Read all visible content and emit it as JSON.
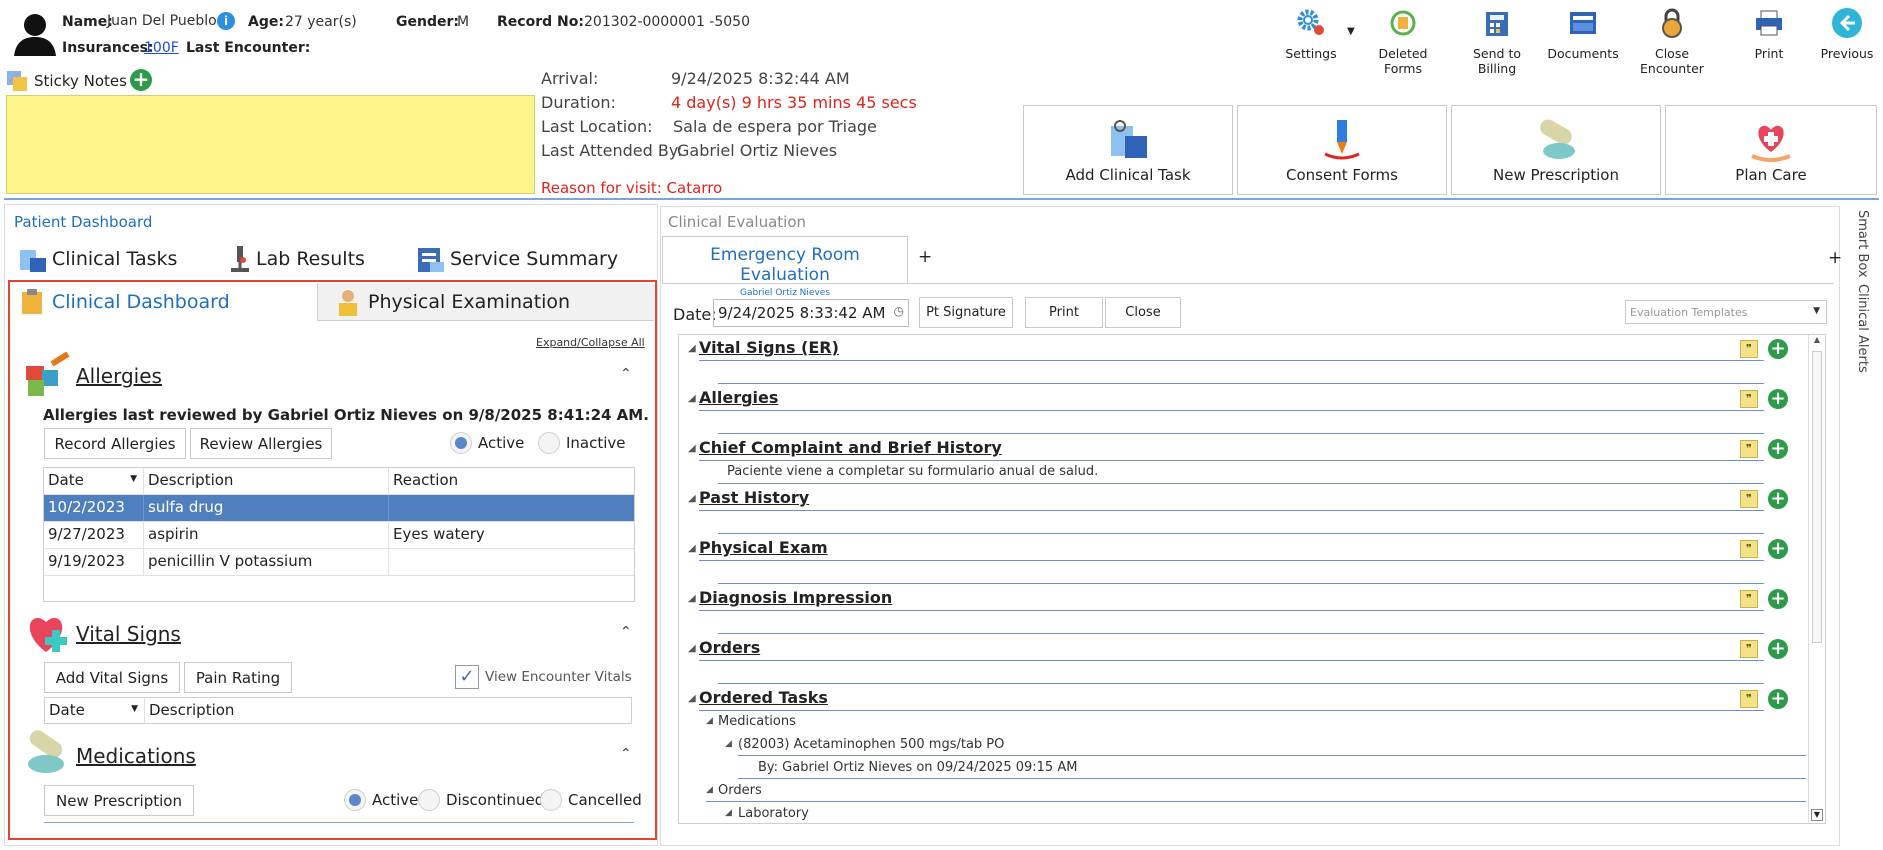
{
  "patient": {
    "name_label": "Name:",
    "name": "Juan Del Pueblo",
    "age_label": "Age:",
    "age": "27 year(s)",
    "gender_label": "Gender:",
    "gender": "M",
    "record_label": "Record No:",
    "record": "201302-0000001 -5050",
    "ins_label": "Insurances:",
    "ins": "100F",
    "last_enc_label": "Last Encounter:"
  },
  "sticky": {
    "label": "Sticky Notes"
  },
  "visit": {
    "arrival_label": "Arrival:",
    "arrival": "9/24/2025 8:32:44 AM",
    "duration_label": "Duration:",
    "duration": "4 day(s) 9 hrs 35 mins 45 secs",
    "location_label": "Last Location:",
    "location": "Sala de espera por Triage",
    "attended_label": "Last Attended By:",
    "attended": "Gabriel Ortiz Nieves",
    "reason": "Reason for visit: Catarro"
  },
  "toolbar": {
    "settings": "Settings",
    "deleted": "Deleted Forms",
    "billing": "Send to Billing",
    "documents": "Documents",
    "close_enc": "Close Encounter",
    "print": "Print",
    "previous": "Previous"
  },
  "actions": {
    "add_task": "Add Clinical Task",
    "consent": "Consent Forms",
    "new_rx": "New Prescription",
    "plan_care": "Plan Care"
  },
  "left": {
    "title": "Patient Dashboard",
    "tab_tasks": "Clinical Tasks",
    "tab_lab": "Lab Results",
    "tab_summary": "Service Summary",
    "tab_dash": "Clinical Dashboard",
    "tab_phys": "Physical Examination",
    "expand": "Expand/Collapse All"
  },
  "allergies": {
    "title": "Allergies",
    "reviewed": "Allergies last reviewed by Gabriel Ortiz Nieves on 9/8/2025 8:41:24 AM.",
    "record_btn": "Record Allergies",
    "review_btn": "Review Allergies",
    "active": "Active",
    "inactive": "Inactive",
    "col_date": "Date",
    "col_desc": "Description",
    "col_react": "Reaction",
    "rows": [
      {
        "date": "10/2/2023",
        "desc": "sulfa drug",
        "react": ""
      },
      {
        "date": "9/27/2023",
        "desc": "aspirin",
        "react": "Eyes watery"
      },
      {
        "date": "9/19/2023",
        "desc": "penicillin V potassium",
        "react": ""
      }
    ]
  },
  "vitals": {
    "title": "Vital Signs",
    "add_btn": "Add Vital Signs",
    "pain_btn": "Pain Rating",
    "view_enc": "View Encounter Vitals",
    "col_date": "Date",
    "col_desc": "Description"
  },
  "meds": {
    "title": "Medications",
    "new_btn": "New Prescription",
    "active": "Active",
    "discontinued": "Discontinued",
    "cancelled": "Cancelled"
  },
  "eval": {
    "title": "Clinical Evaluation",
    "tab": "Emergency Room Evaluation",
    "tab_sub": "Gabriel Ortiz Nieves",
    "plus": "+",
    "date_label": "Date:",
    "date": "9/24/2025 8:33:42 AM",
    "sig_btn": "Pt Signature",
    "print_btn": "Print",
    "close_btn": "Close",
    "templates": "Evaluation Templates",
    "sections": [
      "Vital Signs (ER)",
      "Allergies",
      "Chief Complaint and Brief History",
      "Past History",
      "Physical Exam",
      "Diagnosis Impression",
      "Orders",
      "Ordered Tasks"
    ],
    "chief_note": "Paciente viene a completar su formulario anual de salud.",
    "tasks": {
      "meds": "Medications",
      "med_item": "(82003) Acetaminophen 500 mgs/tab PO",
      "med_by": "By: Gabriel Ortiz Nieves on 09/24/2025 09:15 AM",
      "orders": "Orders",
      "lab": "Laboratory"
    }
  },
  "side": {
    "smart": "Smart Box",
    "alerts": "Clinical Alerts"
  },
  "colors": {
    "accent": "#1f6fc0",
    "red": "#e0231c",
    "sticky": "#fbf58a",
    "selected": "#4f7fbf",
    "green": "#2e9b4b"
  }
}
